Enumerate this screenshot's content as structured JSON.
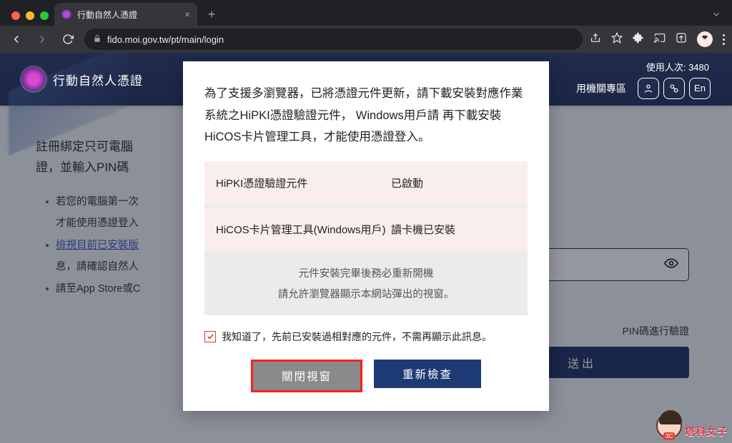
{
  "browser": {
    "tab_title": "行動自然人憑證",
    "url": "fido.moi.gov.tw/pt/main/login"
  },
  "header": {
    "brand": "行動自然人憑證",
    "nav_item": "用機關專區",
    "user_count_label": "使用人次:",
    "user_count_value": "3480",
    "lang_btn": "En"
  },
  "content": {
    "title_line1": "註冊綁定只可電腦",
    "title_line2": "證，並輸入PIN碼",
    "bullets": [
      {
        "text": "若您的電腦第一次",
        "suffix": "才能使用憑證登入"
      },
      {
        "link": "檢視目前已安裝版",
        "suffix": "息，請確認自然人"
      },
      {
        "text": "請至App Store或C"
      }
    ],
    "pin_label": "PIN碼進行驗證",
    "submit_label": "送出"
  },
  "dialog": {
    "message": "為了支援多瀏覽器，已將憑證元件更新，請下載安裝對應作業系統之HiPKI憑證驗證元件， Windows用戶請 再下載安裝HiCOS卡片管理工具，才能使用憑證登入。",
    "rows": [
      {
        "name": "HiPKI憑證驗證元件",
        "status": "已啟動"
      },
      {
        "name": "HiCOS卡片管理工具(Windows用戶)",
        "status": "讀卡機已安裝"
      }
    ],
    "note1": "元件安裝完畢後務必重新開機",
    "note2": "請允許瀏覽器顯示本網站彈出的視窗。",
    "ack_label": "我知道了，先前已安裝過相對應的元件，不需再顯示此訊息。",
    "btn_close": "關閉視窗",
    "btn_recheck": "重新檢查"
  },
  "sticker": {
    "text": "塔科女子"
  }
}
